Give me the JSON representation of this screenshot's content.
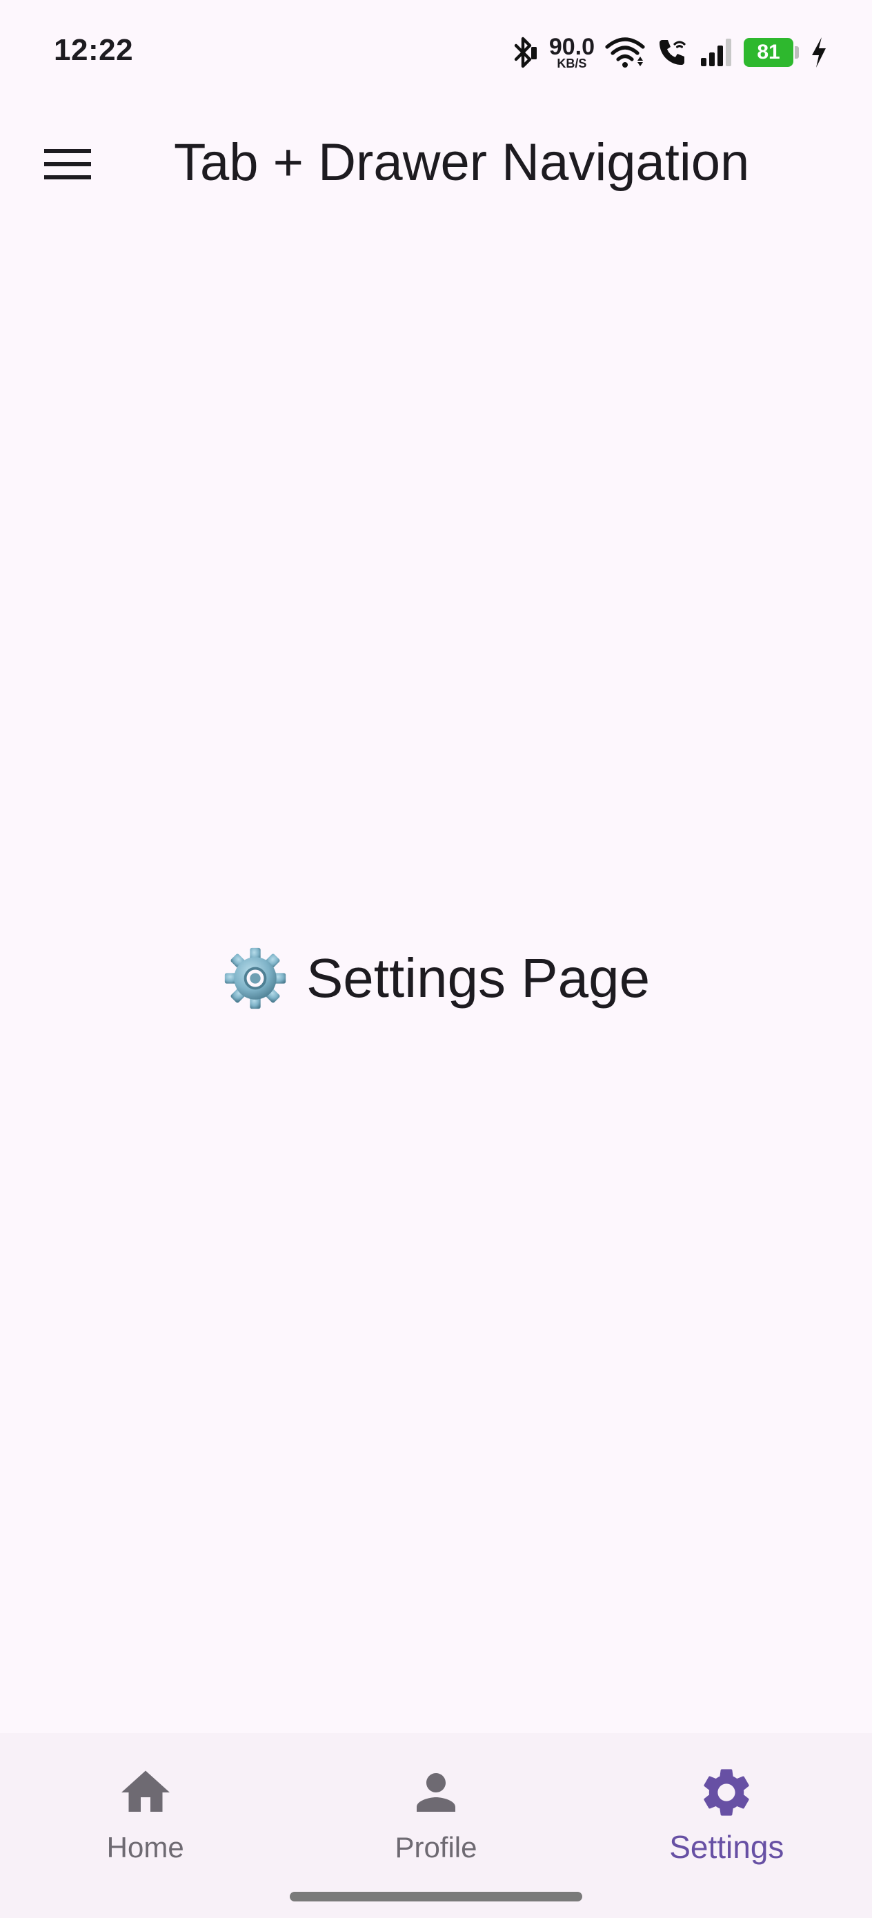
{
  "status_bar": {
    "time": "12:22",
    "net_speed_value": "90.0",
    "net_speed_unit": "KB/S",
    "battery_level": "81",
    "icons": [
      "bluetooth-icon",
      "wifi-icon",
      "wifi-calling-icon",
      "cellular-signal-icon",
      "battery-icon",
      "charging-bolt-icon"
    ]
  },
  "app_bar": {
    "title": "Tab + Drawer Navigation",
    "menu_icon": "hamburger-menu-icon"
  },
  "main": {
    "heading": "Settings Page",
    "heading_icon": "gear-emoji-icon"
  },
  "bottom_nav": {
    "items": [
      {
        "label": "Home",
        "icon": "home-icon",
        "active": false
      },
      {
        "label": "Profile",
        "icon": "person-icon",
        "active": false
      },
      {
        "label": "Settings",
        "icon": "settings-icon",
        "active": true
      }
    ]
  },
  "colors": {
    "background": "#FDF7FD",
    "nav_background": "#F8F1F8",
    "accent": "#6750A4",
    "inactive": "#6E6A72",
    "text": "#1D1B20",
    "battery": "#2EB82E"
  }
}
